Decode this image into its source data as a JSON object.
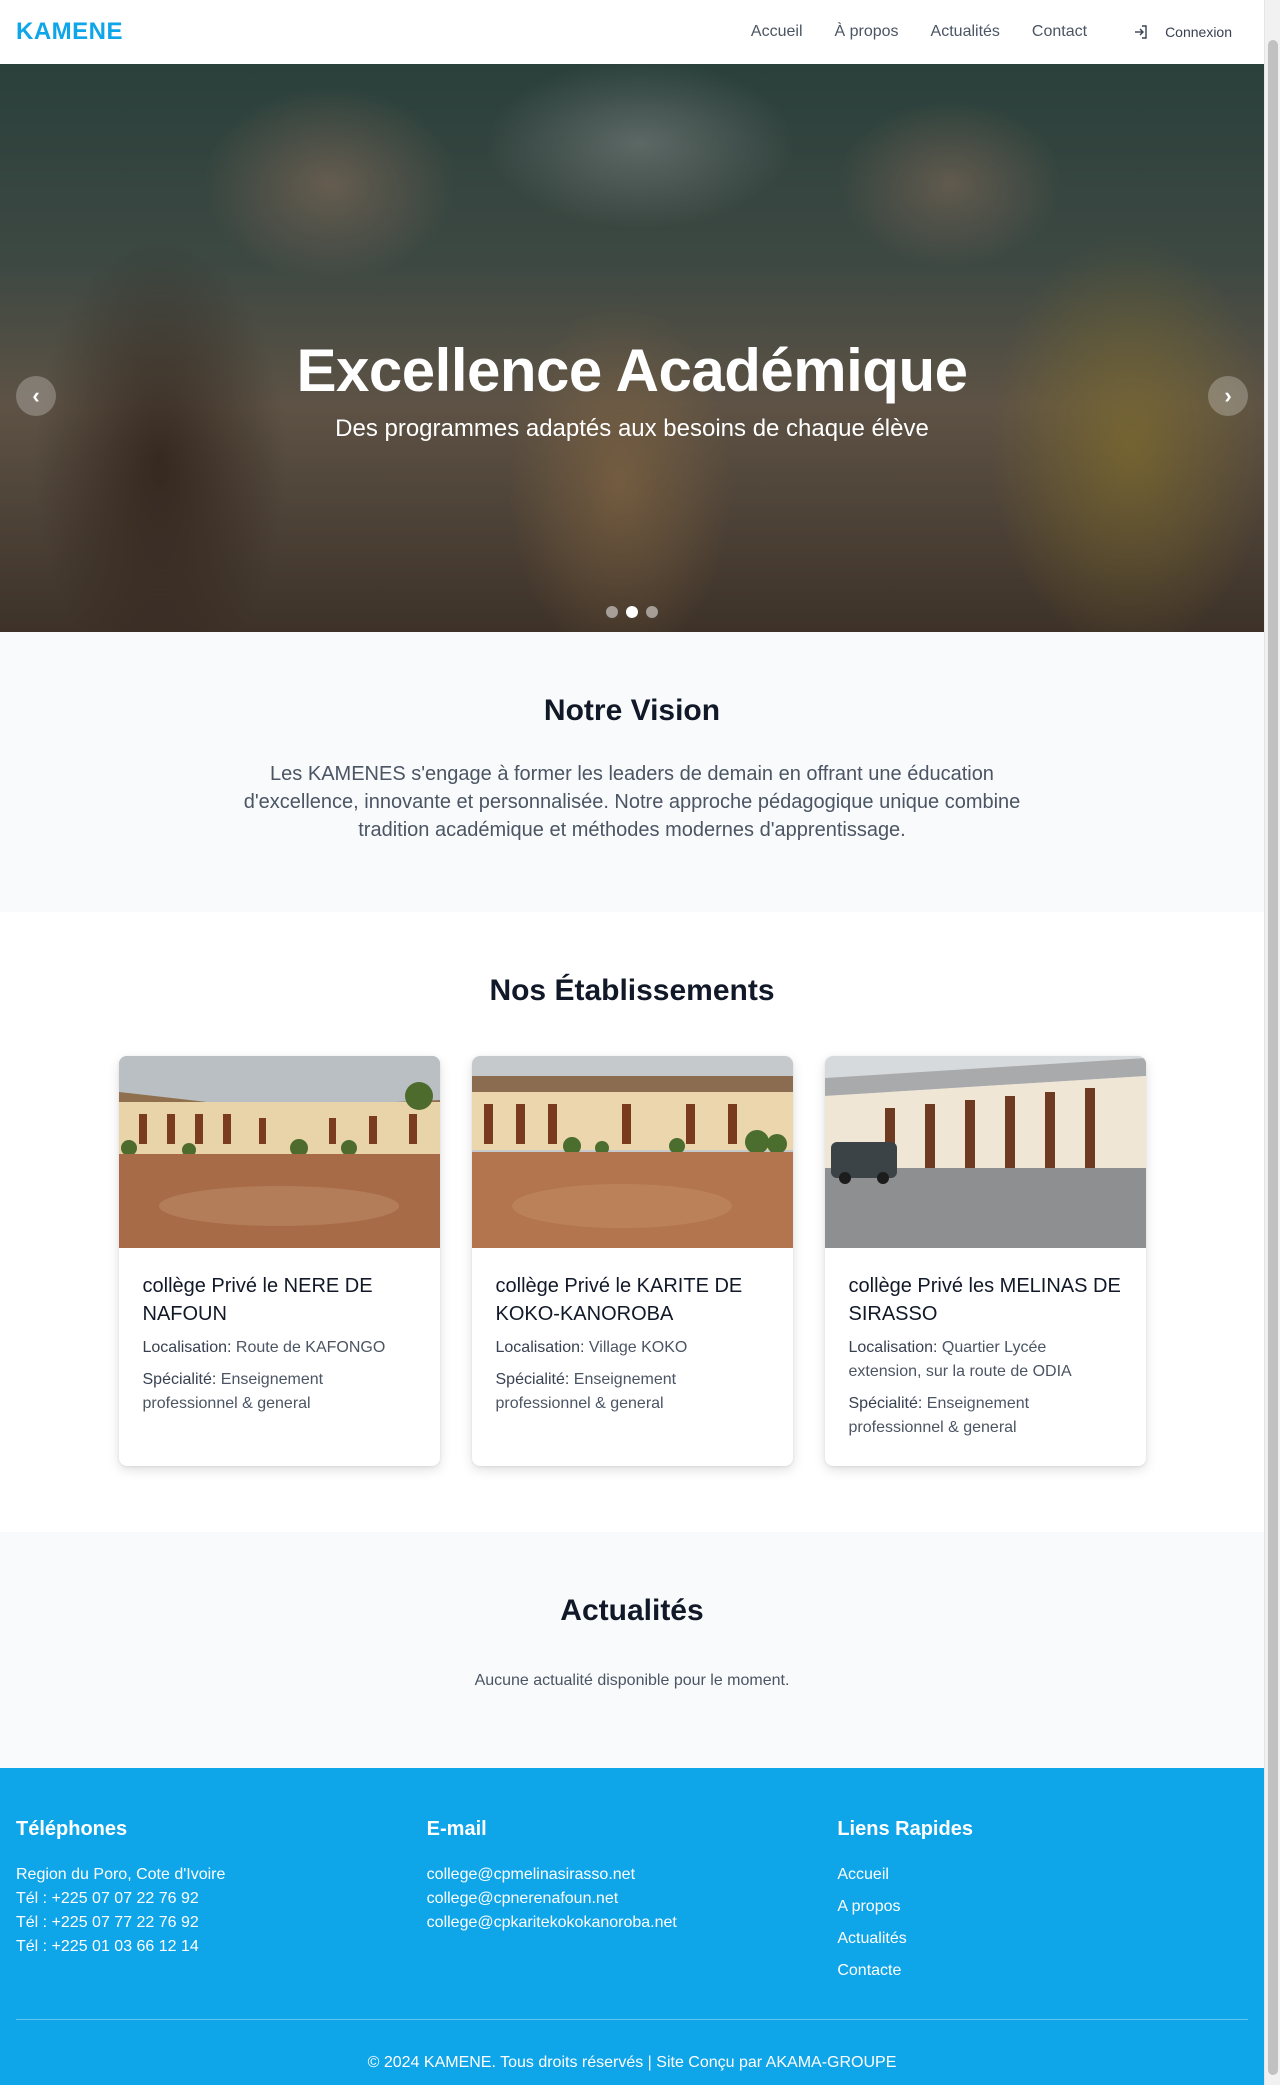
{
  "header": {
    "logo": "KAMENE",
    "nav": [
      "Accueil",
      "À propos",
      "Actualités",
      "Contact"
    ],
    "login": "Connexion"
  },
  "hero": {
    "title": "Excellence Académique",
    "subtitle": "Des programmes adaptés aux besoins de chaque élève",
    "prev_icon": "chevron-left-icon",
    "next_icon": "chevron-right-icon",
    "slides": 3,
    "active_slide": 2
  },
  "vision": {
    "title": "Notre Vision",
    "text": "Les KAMENES s'engage à former les leaders de demain en offrant une éducation d'excellence, innovante et personnalisée. Notre approche pédagogique unique combine tradition académique et méthodes modernes d'apprentissage."
  },
  "etablissements": {
    "title": "Nos Établissements",
    "loc_label": "Localisation:",
    "spec_label": "Spécialité:",
    "cards": [
      {
        "name": "collège Privé le NERE DE NAFOUN",
        "localisation": "Route de KAFONGO",
        "specialite": "Enseignement professionnel & general"
      },
      {
        "name": "collège Privé le KARITE DE KOKO-KANOROBA",
        "localisation": "Village KOKO",
        "specialite": "Enseignement professionnel & general"
      },
      {
        "name": "collège Privé les MELINAS DE SIRASSO",
        "localisation": "Quartier Lycée extension, sur la route de ODIA",
        "specialite": "Enseignement professionnel & general"
      }
    ]
  },
  "actualites": {
    "title": "Actualités",
    "empty": "Aucune actualité disponible pour le moment."
  },
  "footer": {
    "phones_title": "Téléphones",
    "phones": [
      "Region du Poro, Cote d'Ivoire",
      "Tél : +225 07 07 22 76 92",
      "Tél : +225 07 77 22 76 92",
      "Tél : +225 01 03 66 12 14"
    ],
    "email_title": "E-mail",
    "emails": [
      "college@cpmelinasirasso.net",
      "college@cpnerenafoun.net",
      "college@cpkaritekokokanoroba.net"
    ],
    "links_title": "Liens Rapides",
    "links": [
      "Accueil",
      "A propos",
      "Actualités",
      "Contacte"
    ],
    "copyright": "© 2024 KAMENE. Tous droits réservés | Site Conçu par AKAMA-GROUPE"
  },
  "colors": {
    "brand": "#0ea5e9",
    "section_bg": "#f8fafc"
  }
}
